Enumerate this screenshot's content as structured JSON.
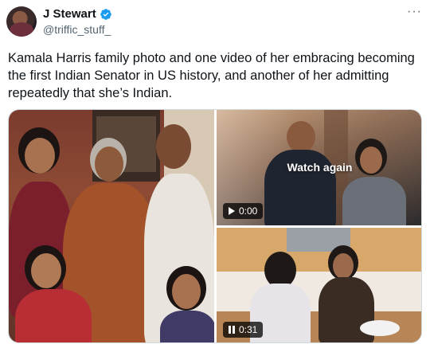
{
  "author": {
    "display_name": "J Stewart",
    "handle": "@triffic_stuff_",
    "verified_icon": "verified-badge-icon",
    "verified_color": "#1d9bf0"
  },
  "more_label": "···",
  "tweet": {
    "text": "Kamala Harris family photo and one video of her embracing becoming the first Indian Senator in US history, and another of her admitting repeatedly that she’s Indian."
  },
  "media": {
    "video1": {
      "overlay_label": "Watch again",
      "time": "0:00",
      "control_icon": "play-icon"
    },
    "video2": {
      "time": "0:31",
      "control_icon": "pause-icon"
    }
  }
}
